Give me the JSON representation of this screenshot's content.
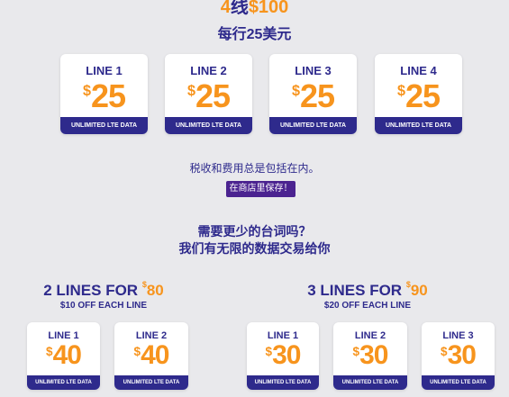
{
  "hero": {
    "prefix_num": "4",
    "prefix_cn": "线",
    "price": "$100",
    "subtitle": "每行25美元"
  },
  "main_lines": [
    {
      "label": "LINE 1",
      "currency": "$",
      "amount": "25",
      "band": "UNLIMITED LTE DATA"
    },
    {
      "label": "LINE 2",
      "currency": "$",
      "amount": "25",
      "band": "UNLIMITED LTE DATA"
    },
    {
      "label": "LINE 3",
      "currency": "$",
      "amount": "25",
      "band": "UNLIMITED LTE DATA"
    },
    {
      "label": "LINE 4",
      "currency": "$",
      "amount": "25",
      "band": "UNLIMITED LTE DATA"
    }
  ],
  "note": "税收和费用总是包括在内。",
  "save_button": "在商店里保存！",
  "question": {
    "line1": "需要更少的台词吗？",
    "line2": "我们有无限的数据交易给你"
  },
  "offer_2": {
    "title": "2 LINES FOR ",
    "currency": "$",
    "price": "80",
    "subtitle": "$10 OFF EACH LINE",
    "lines": [
      {
        "label": "LINE 1",
        "currency": "$",
        "amount": "40",
        "band": "UNLIMITED LTE DATA"
      },
      {
        "label": "LINE 2",
        "currency": "$",
        "amount": "40",
        "band": "UNLIMITED LTE DATA"
      }
    ]
  },
  "offer_3": {
    "title": "3 LINES FOR ",
    "currency": "$",
    "price": "90",
    "subtitle": "$20 OFF EACH LINE",
    "lines": [
      {
        "label": "LINE 1",
        "currency": "$",
        "amount": "30",
        "band": "UNLIMITED LTE DATA"
      },
      {
        "label": "LINE 2",
        "currency": "$",
        "amount": "30",
        "band": "UNLIMITED LTE DATA"
      },
      {
        "label": "LINE 3",
        "currency": "$",
        "amount": "30",
        "band": "UNLIMITED LTE DATA"
      }
    ]
  },
  "colors": {
    "navy": "#2e2a8c",
    "orange": "#f7941d",
    "button": "#4b2390",
    "background": "#e9e9ec"
  }
}
